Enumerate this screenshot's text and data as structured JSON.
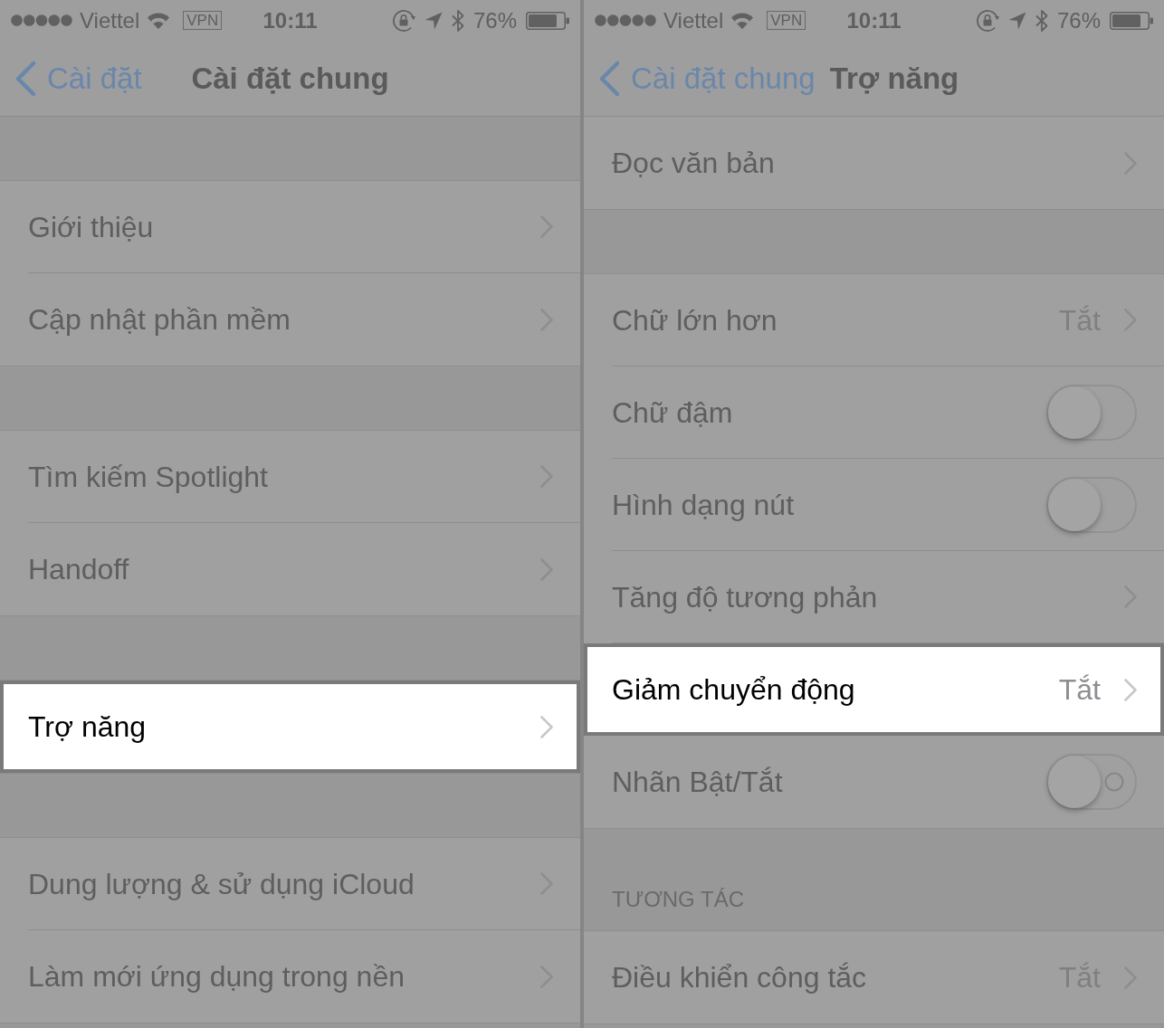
{
  "panels": [
    {
      "status_bar": {
        "carrier": "Viettel",
        "vpn": "VPN",
        "time": "10:11",
        "battery": "76%"
      },
      "nav_bar": {
        "back": "Cài đặt",
        "title": "Cài đặt chung"
      },
      "sections": [
        {
          "partial": false,
          "rows": [
            {
              "label": "Giới thiệu",
              "kind": "link",
              "highlighted": false
            },
            {
              "label": "Cập nhật phần mềm",
              "kind": "link",
              "highlighted": false
            }
          ]
        },
        {
          "partial": false,
          "rows": [
            {
              "label": "Tìm kiếm Spotlight",
              "kind": "link",
              "highlighted": false
            },
            {
              "label": "Handoff",
              "kind": "link",
              "highlighted": false
            }
          ]
        },
        {
          "partial": false,
          "rows": [
            {
              "label": "Trợ năng",
              "kind": "link",
              "highlighted": true
            }
          ]
        },
        {
          "partial": false,
          "rows": [
            {
              "label": "Dung lượng & sử dụng iCloud",
              "kind": "link",
              "highlighted": false
            },
            {
              "label": "Làm mới ứng dụng trong nền",
              "kind": "link",
              "highlighted": false
            }
          ]
        }
      ]
    },
    {
      "status_bar": {
        "carrier": "Viettel",
        "vpn": "VPN",
        "time": "10:11",
        "battery": "76%"
      },
      "nav_bar": {
        "back": "Cài đặt chung",
        "title": "Trợ năng"
      },
      "sections": [
        {
          "partial": true,
          "rows": [
            {
              "label": "Đọc văn bản",
              "kind": "link",
              "highlighted": false
            }
          ]
        },
        {
          "partial": false,
          "rows": [
            {
              "label": "Chữ lớn hơn",
              "kind": "link",
              "value": "Tắt",
              "highlighted": false
            },
            {
              "label": "Chữ đậm",
              "kind": "toggle",
              "on": false,
              "on_off_label": false,
              "highlighted": false
            },
            {
              "label": "Hình dạng nút",
              "kind": "toggle",
              "on": false,
              "on_off_label": false,
              "highlighted": false
            },
            {
              "label": "Tăng độ tương phản",
              "kind": "link",
              "highlighted": false
            },
            {
              "label": "Giảm chuyển động",
              "kind": "link",
              "value": "Tắt",
              "highlighted": true
            },
            {
              "label": "Nhãn Bật/Tắt",
              "kind": "toggle",
              "on": false,
              "on_off_label": true,
              "highlighted": false
            }
          ]
        },
        {
          "partial": false,
          "header": "TƯƠNG TÁC",
          "rows": [
            {
              "label": "Điều khiển công tắc",
              "kind": "link",
              "value": "Tắt",
              "highlighted": false
            }
          ]
        }
      ]
    }
  ]
}
